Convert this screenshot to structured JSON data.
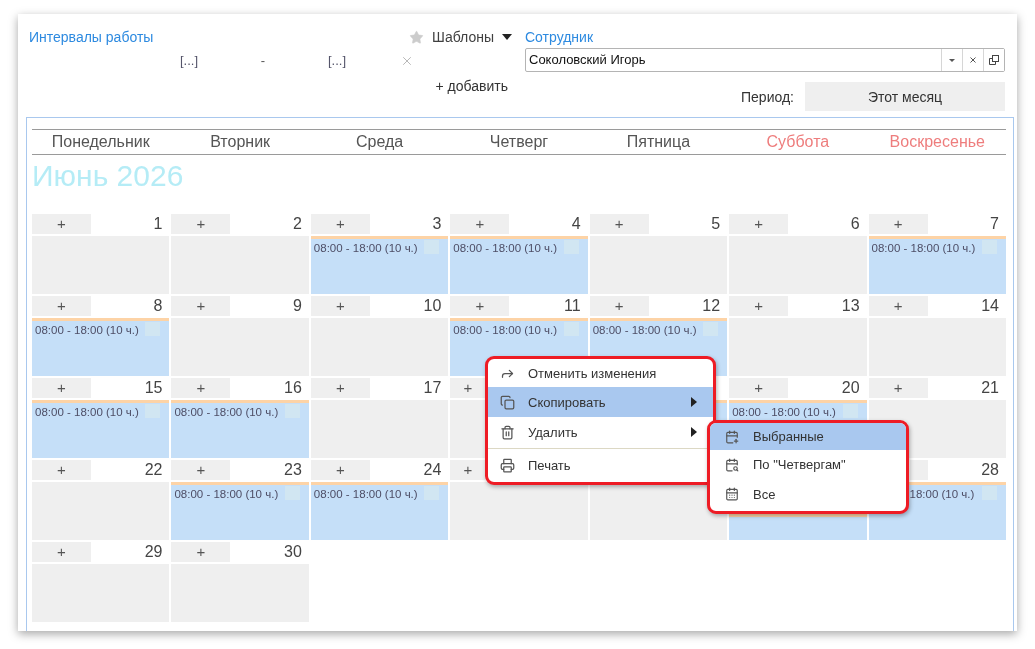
{
  "intervals": {
    "title": "Интервалы работы",
    "templates_button": "Шаблоны",
    "rows": [
      {
        "start": "[...]",
        "separator": "-",
        "end": "[...]"
      }
    ],
    "add_link": "+ добавить"
  },
  "employee": {
    "label": "Сотрудник",
    "value": "Соколовский Игорь"
  },
  "period": {
    "label": "Период:",
    "value": "Этот месяц"
  },
  "calendar": {
    "weekdays": [
      {
        "name": "Понедельник",
        "weekend": false
      },
      {
        "name": "Вторник",
        "weekend": false
      },
      {
        "name": "Среда",
        "weekend": false
      },
      {
        "name": "Четверг",
        "weekend": false
      },
      {
        "name": "Пятница",
        "weekend": false
      },
      {
        "name": "Суббота",
        "weekend": true
      },
      {
        "name": "Воскресенье",
        "weekend": true
      }
    ],
    "month_title": "Июнь 2026",
    "weeks": [
      [
        {
          "day": "1",
          "add": "+",
          "scheduled": false
        },
        {
          "day": "2",
          "add": "+",
          "scheduled": false
        },
        {
          "day": "3",
          "add": "+",
          "scheduled": true,
          "shift": "08:00 - 18:00 (10 ч.)"
        },
        {
          "day": "4",
          "add": "+",
          "scheduled": true,
          "shift": "08:00 - 18:00 (10 ч.)"
        },
        {
          "day": "5",
          "add": "+",
          "scheduled": false
        },
        {
          "day": "6",
          "add": "+",
          "scheduled": false
        },
        {
          "day": "7",
          "add": "+",
          "scheduled": true,
          "shift": "08:00 - 18:00 (10 ч.)"
        }
      ],
      [
        {
          "day": "8",
          "add": "+",
          "scheduled": true,
          "shift": "08:00 - 18:00 (10 ч.)"
        },
        {
          "day": "9",
          "add": "+",
          "scheduled": false
        },
        {
          "day": "10",
          "add": "+",
          "scheduled": false
        },
        {
          "day": "11",
          "add": "+",
          "scheduled": true,
          "shift": "08:00 - 18:00 (10 ч.)"
        },
        {
          "day": "12",
          "add": "+",
          "scheduled": true,
          "shift": "08:00 - 18:00 (10 ч.)"
        },
        {
          "day": "13",
          "add": "+",
          "scheduled": false
        },
        {
          "day": "14",
          "add": "+",
          "scheduled": false
        }
      ],
      [
        {
          "day": "15",
          "add": "+",
          "scheduled": true,
          "shift": "08:00 - 18:00 (10 ч.)"
        },
        {
          "day": "16",
          "add": "+",
          "scheduled": true,
          "shift": "08:00 - 18:00 (10 ч.)"
        },
        {
          "day": "17",
          "add": "+",
          "scheduled": false
        },
        {
          "add": "+",
          "scheduled": false
        },
        {
          "scheduled": true
        },
        {
          "day": "20",
          "add": "+",
          "scheduled": true,
          "shift": "08:00 - 18:00 (10 ч.)"
        },
        {
          "day": "21",
          "add": "+",
          "scheduled": false
        }
      ],
      [
        {
          "day": "22",
          "add": "+",
          "scheduled": false
        },
        {
          "day": "23",
          "add": "+",
          "scheduled": true,
          "shift": "08:00 - 18:00 (10 ч.)"
        },
        {
          "day": "24",
          "add": "+",
          "scheduled": true,
          "shift": "08:00 - 18:00 (10 ч.)"
        },
        {
          "add": "+",
          "scheduled": false
        },
        {
          "scheduled": false
        },
        {
          "scheduled": true
        },
        {
          "day": "28",
          "scheduled": true,
          "shift": "18:00 (10 ч.)"
        }
      ],
      [
        {
          "day": "29",
          "add": "+",
          "scheduled": false
        },
        {
          "day": "30",
          "add": "+",
          "scheduled": false
        }
      ]
    ]
  },
  "context_menu": {
    "items": [
      {
        "label": "Отменить изменения",
        "selected": false,
        "has_submenu": false,
        "divider_above": false
      },
      {
        "label": "Скопировать",
        "selected": true,
        "has_submenu": true,
        "divider_above": false
      },
      {
        "label": "Удалить",
        "selected": false,
        "has_submenu": true,
        "divider_above": false
      },
      {
        "label": "Печать",
        "selected": false,
        "has_submenu": false,
        "divider_above": true
      }
    ]
  },
  "submenu": {
    "items": [
      {
        "label": "Выбранные",
        "selected": true
      },
      {
        "label": "По \"Четвергам\"",
        "selected": false
      },
      {
        "label": "Все",
        "selected": false
      }
    ]
  }
}
